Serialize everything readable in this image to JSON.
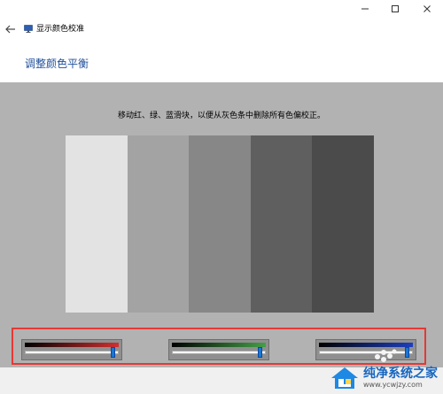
{
  "window": {
    "controls": [
      "minimize",
      "maximize",
      "close"
    ]
  },
  "nav": {
    "back_icon": "back-arrow-icon",
    "app_icon": "monitor-icon",
    "app_title": "显示颜色校准"
  },
  "page": {
    "title": "调整颜色平衡",
    "instruction": "移动红、绿、蓝滑块，以便从灰色条中删除所有色偏校正。",
    "colors": {
      "title": "#1f4f9a",
      "gray_area": "#b2b2b2",
      "highlight_border": "#e53935"
    }
  },
  "gray_bars": [
    "#e3e3e3",
    "#a3a3a3",
    "#878787",
    "#5f5f5f",
    "#4b4b4b"
  ],
  "sliders": [
    {
      "name": "red",
      "color": "#d32f2f",
      "value_percent": 96
    },
    {
      "name": "green",
      "color": "#43a047",
      "value_percent": 96
    },
    {
      "name": "blue",
      "color": "#1e3fbf",
      "value_percent": 96
    }
  ],
  "watermark": {
    "name": "纯净系统之家",
    "url": "www.ycwjzy.com"
  }
}
